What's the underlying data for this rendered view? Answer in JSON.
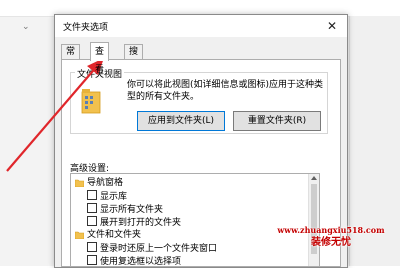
{
  "dialog": {
    "title": "文件夹选项",
    "close_glyph": "✕",
    "tabs": [
      {
        "label": "常规"
      },
      {
        "label": "查看"
      },
      {
        "label": "搜索"
      }
    ],
    "active_tab": "查看"
  },
  "folder_views": {
    "title": "文件夹视图",
    "description": "你可以将此视图(如详细信息或图标)应用于这种类型的所有文件夹。",
    "apply_button": "应用到文件夹(L)",
    "reset_button": "重置文件夹(R)"
  },
  "advanced": {
    "label": "高级设置:",
    "items": [
      {
        "label": "导航窗格",
        "type": "folder",
        "indent": 0
      },
      {
        "label": "显示库",
        "type": "checkbox",
        "checked": false,
        "indent": 1
      },
      {
        "label": "显示所有文件夹",
        "type": "checkbox",
        "checked": false,
        "indent": 1
      },
      {
        "label": "展开到打开的文件夹",
        "type": "checkbox",
        "checked": false,
        "indent": 1
      },
      {
        "label": "文件和文件夹",
        "type": "folder",
        "indent": 0
      },
      {
        "label": "登录时还原上一个文件夹窗口",
        "type": "checkbox",
        "checked": false,
        "indent": 1
      },
      {
        "label": "使用复选框以选择项",
        "type": "checkbox",
        "checked": false,
        "indent": 1
      }
    ]
  },
  "watermark": {
    "url": "www.zhuangxiu518.com",
    "name": "装修无忧"
  },
  "colors": {
    "arrow": "#e0262b",
    "watermark": "#c40000",
    "folder": "#f2c14e",
    "accent": "#0078d7"
  },
  "icons": {
    "close": "close-icon",
    "folder": "folder-icon",
    "checkbox": "checkbox-icon",
    "pointer_arrow": "red-arrow-icon"
  }
}
